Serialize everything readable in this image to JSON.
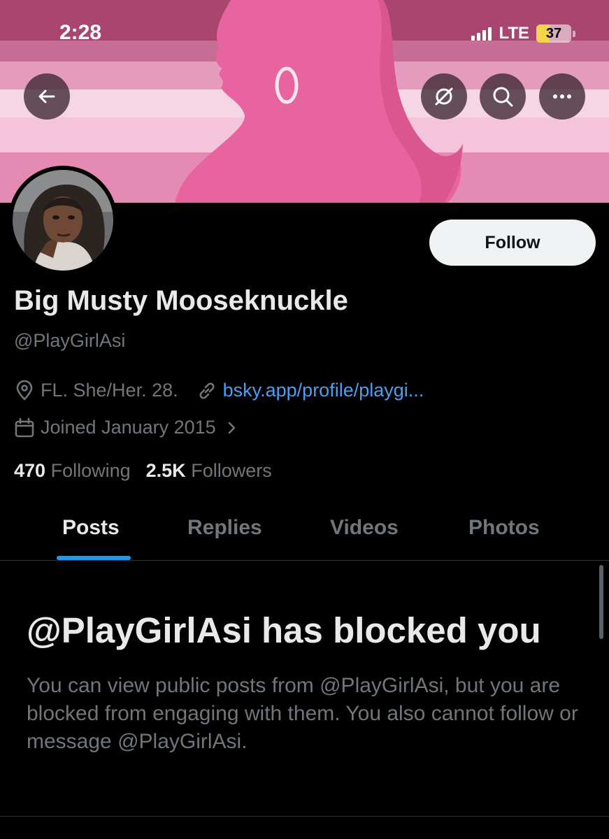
{
  "status_bar": {
    "time": "2:28",
    "network": "LTE",
    "battery_percent": "37"
  },
  "nav": {
    "back_icon": "arrow-left-icon",
    "grok_icon": "slashed-circle-icon",
    "search_icon": "search-icon",
    "more_icon": "more-horizontal-icon"
  },
  "profile": {
    "follow_label": "Follow",
    "display_name": "Big Musty Mooseknuckle",
    "handle": "@PlayGirlAsi",
    "location": "FL. She/Her. 28.",
    "website": "bsky.app/profile/playgi...",
    "joined": "Joined January 2015",
    "following_count": "470",
    "following_label": "Following",
    "followers_count": "2.5K",
    "followers_label": "Followers"
  },
  "tabs": [
    {
      "label": "Posts",
      "active": true
    },
    {
      "label": "Replies",
      "active": false
    },
    {
      "label": "Videos",
      "active": false
    },
    {
      "label": "Photos",
      "active": false
    }
  ],
  "blocked": {
    "title": "@PlayGirlAsi has blocked you",
    "message": "You can view public posts from @PlayGirlAsi, but you are blocked from engaging with them. You also cannot follow or message @PlayGirlAsi."
  },
  "colors": {
    "accent": "#1d9bf0",
    "link": "#4a9ff0",
    "muted_text": "#71767b",
    "banner_pink": "#e8649e"
  }
}
